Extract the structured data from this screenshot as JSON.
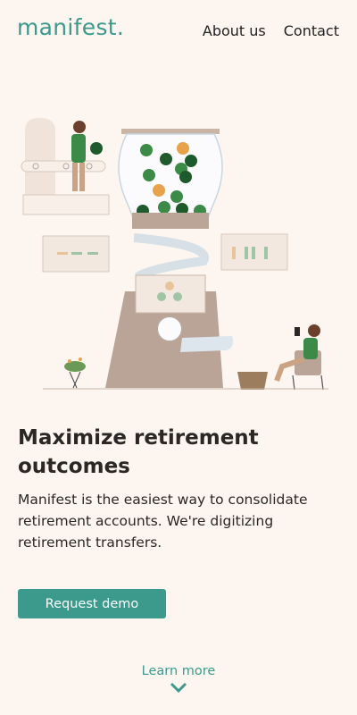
{
  "brand": {
    "logo_text": "manifest."
  },
  "nav": {
    "items": [
      {
        "label": "About us"
      },
      {
        "label": "Contact"
      }
    ]
  },
  "hero": {
    "title": "Maximize retirement outcomes",
    "description": "Manifest is the easiest way to consolidate retirement accounts. We're digitizing retirement transfers.",
    "cta_label": "Request demo",
    "learn_more_label": "Learn more"
  },
  "colors": {
    "accent": "#3b9a8c",
    "background": "#fdf6f0",
    "text": "#2a2724"
  },
  "icons": {
    "learn_more": "chevron-down-icon"
  }
}
